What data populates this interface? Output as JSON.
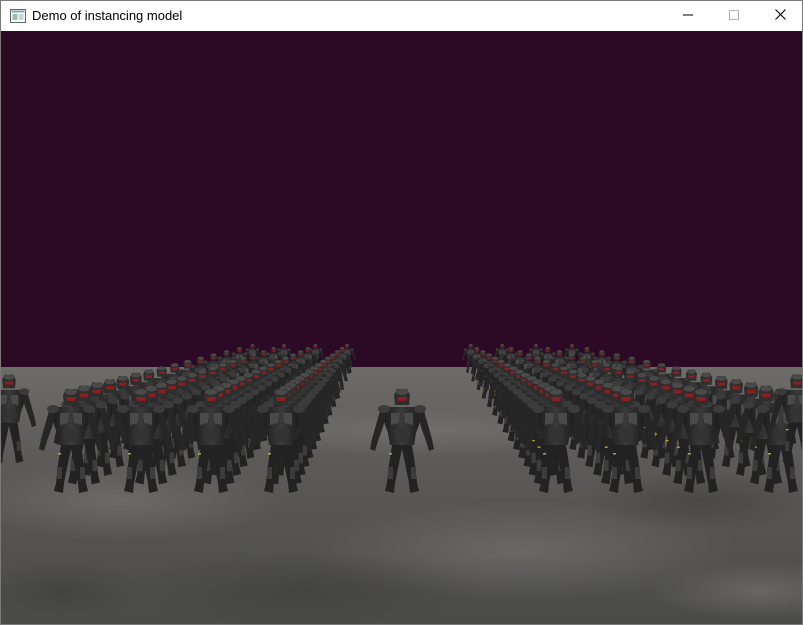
{
  "window": {
    "title": "Demo of instancing model",
    "buttons": {
      "minimize": "minimize",
      "maximize": "maximize",
      "close": "close"
    }
  },
  "scene": {
    "clear_color": "#2c0a25",
    "floor_color": "#5a5a58",
    "floor_far_color": "#6c6a66",
    "figure_color": "#2b2b2b",
    "visor_color": "#8a1f1f",
    "accent_color": "#c9a21a"
  }
}
